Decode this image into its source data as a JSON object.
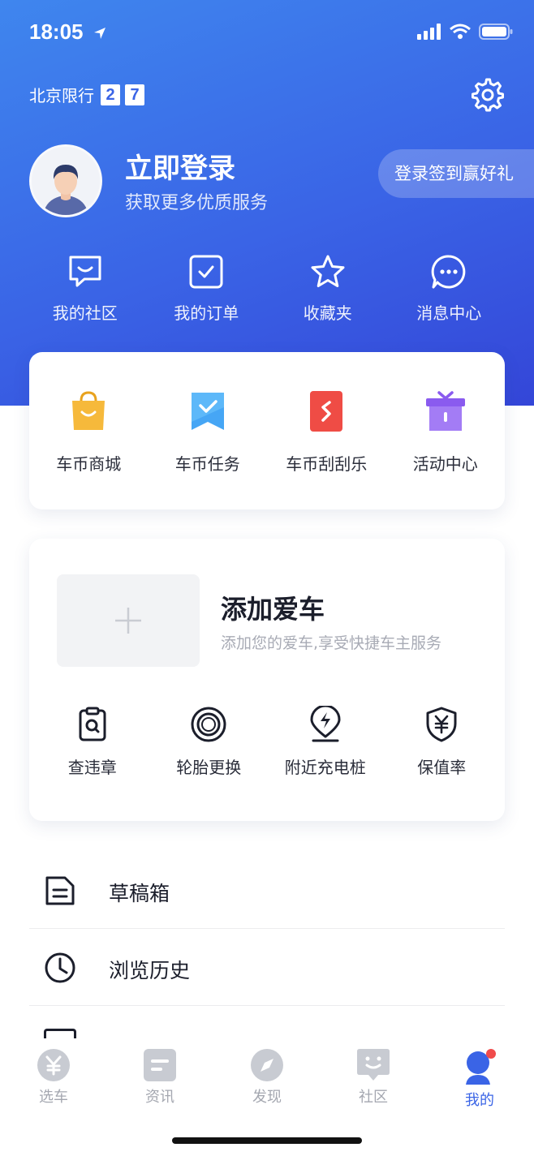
{
  "status_bar": {
    "time": "18:05"
  },
  "header": {
    "restriction_label": "北京限行",
    "restriction_numbers": [
      "2",
      "7"
    ]
  },
  "profile": {
    "title": "立即登录",
    "subtitle": "获取更多优质服务",
    "sign_in_promo": "登录签到赢好礼"
  },
  "quick_links": [
    {
      "label": "我的社区",
      "icon": "chat-bubble-smile-icon"
    },
    {
      "label": "我的订单",
      "icon": "checkbox-icon"
    },
    {
      "label": "收藏夹",
      "icon": "star-icon"
    },
    {
      "label": "消息中心",
      "icon": "message-dots-icon"
    }
  ],
  "coin_services": [
    {
      "label": "车币商城",
      "icon": "shopping-bag-icon",
      "color": "#f6b93b"
    },
    {
      "label": "车币任务",
      "icon": "task-flag-icon",
      "color": "#46a6f5"
    },
    {
      "label": "车币刮刮乐",
      "icon": "scratch-card-icon",
      "color": "#ef4c45"
    },
    {
      "label": "活动中心",
      "icon": "gift-box-icon",
      "color": "#8a5bef"
    }
  ],
  "my_car": {
    "title": "添加爱车",
    "subtitle": "添加您的爱车,享受快捷车主服务",
    "tools": [
      {
        "label": "查违章",
        "icon": "clipboard-search-icon"
      },
      {
        "label": "轮胎更换",
        "icon": "tire-icon"
      },
      {
        "label": "附近充电桩",
        "icon": "charging-pin-icon"
      },
      {
        "label": "保值率",
        "icon": "yuan-shield-icon"
      }
    ]
  },
  "menu_list": [
    {
      "label": "草稿箱",
      "icon": "draft-document-icon"
    },
    {
      "label": "浏览历史",
      "icon": "clock-icon"
    }
  ],
  "tabbar": {
    "items": [
      {
        "label": "选车",
        "icon": "yuan-coin-icon"
      },
      {
        "label": "资讯",
        "icon": "news-icon"
      },
      {
        "label": "发现",
        "icon": "compass-icon"
      },
      {
        "label": "社区",
        "icon": "community-face-icon"
      },
      {
        "label": "我的",
        "icon": "profile-icon"
      }
    ],
    "active": "我的"
  },
  "colors": {
    "brand_blue": "#3a64e6",
    "tab_inactive": "#a4a7b0",
    "notification_dot": "#f04b4b"
  }
}
